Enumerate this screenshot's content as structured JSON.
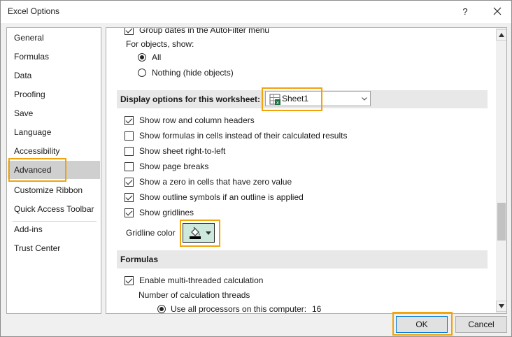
{
  "window": {
    "title": "Excel Options",
    "help_label": "?",
    "close_icon": "close-icon"
  },
  "nav": {
    "items": [
      "General",
      "Formulas",
      "Data",
      "Proofing",
      "Save",
      "Language",
      "Accessibility",
      "Advanced",
      "Customize Ribbon",
      "Quick Access Toolbar",
      "Add-ins",
      "Trust Center"
    ],
    "active": "Advanced"
  },
  "content": {
    "top_partial": "Group dates in the AutoFilter menu",
    "objects_label": "For objects, show:",
    "radio_all": "All",
    "radio_nothing": "Nothing (hide objects)",
    "worksheet_section": "Display options for this worksheet:",
    "sheet_select": "Sheet1",
    "ws_options": [
      {
        "label": "Show row and column headers",
        "checked": true
      },
      {
        "label": "Show formulas in cells instead of their calculated results",
        "checked": false
      },
      {
        "label": "Show sheet right-to-left",
        "checked": false
      },
      {
        "label": "Show page breaks",
        "checked": false
      },
      {
        "label": "Show a zero in cells that have zero value",
        "checked": true
      },
      {
        "label": "Show outline symbols if an outline is applied",
        "checked": true
      },
      {
        "label": "Show gridlines",
        "checked": true
      }
    ],
    "gridline_color_label": "Gridline color",
    "formulas_section": "Formulas",
    "multithread_label": "Enable multi-threaded calculation",
    "threads_label": "Number of calculation threads",
    "use_all_label": "Use all processors on this computer:",
    "processor_count": "16"
  },
  "footer": {
    "ok": "OK",
    "cancel": "Cancel"
  },
  "colors": {
    "highlight": "#f0a30a",
    "active_nav": "#cfcfcf",
    "section_bg": "#e8e8e8"
  }
}
